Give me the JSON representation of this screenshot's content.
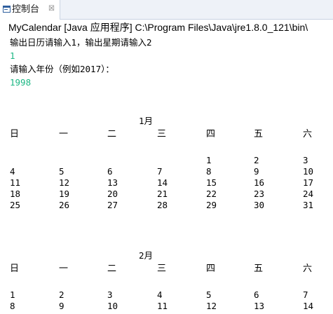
{
  "console_tab": {
    "icon": "console-icon",
    "label": "控制台",
    "close_glyph": "☒"
  },
  "launch_line": "MyCalendar [Java 应用程序] C:\\Program Files\\Java\\jre1.8.0_121\\bin\\",
  "prompt_mode": "输出日历请输入1，输出星期请输入2",
  "input_mode": "1",
  "prompt_year": "请输入年份（例如2017）：",
  "input_year": "1998",
  "colors": {
    "input_text": "#1cb784",
    "tab_bar_bg": "#eef2f8"
  },
  "weekday_headers": [
    "日",
    "一",
    "二",
    "三",
    "四",
    "五",
    "六"
  ],
  "months": [
    {
      "title": "1月",
      "rows": [
        [
          "",
          "",
          "",
          "",
          "1",
          "2",
          "3"
        ],
        [
          "4",
          "5",
          "6",
          "7",
          "8",
          "9",
          "10"
        ],
        [
          "11",
          "12",
          "13",
          "14",
          "15",
          "16",
          "17"
        ],
        [
          "18",
          "19",
          "20",
          "21",
          "22",
          "23",
          "24"
        ],
        [
          "25",
          "26",
          "27",
          "28",
          "29",
          "30",
          "31"
        ]
      ]
    },
    {
      "title": "2月",
      "rows": [
        [
          "1",
          "2",
          "3",
          "4",
          "5",
          "6",
          "7"
        ],
        [
          "8",
          "9",
          "10",
          "11",
          "12",
          "13",
          "14"
        ]
      ]
    }
  ]
}
